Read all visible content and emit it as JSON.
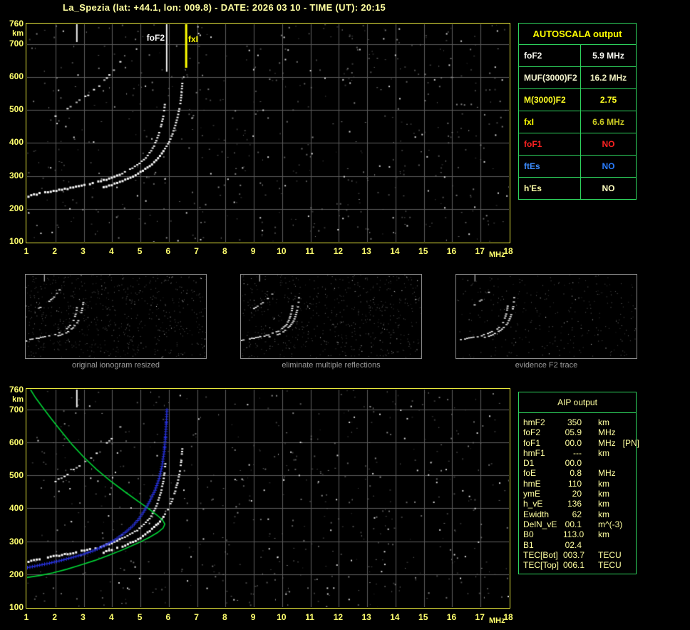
{
  "title": "La_Spezia (lat: +44.1, lon: 009.8) - DATE: 2026 03 10 - TIME (UT): 20:15",
  "colors": {
    "frame": "#e8e83c",
    "grid": "#5c5c5c",
    "axis_text": "#ffff6e",
    "title_text": "#ffffa0",
    "table_border": "#2ed55e",
    "caption_text": "#9c9c9c",
    "green_curve": "#00d435",
    "blue_trace": "#2a35e8",
    "trace_white": "#f5f5f5",
    "noise_gray": "#969696"
  },
  "autoscala": {
    "header": "AUTOSCALA output",
    "rows": [
      {
        "label": "foF2",
        "value": "5.9 MHz",
        "label_color": "#f8f8f0",
        "value_color": "#fbfbf5"
      },
      {
        "label": "MUF(3000)F2",
        "value": "16.2 MHz",
        "label_color": "#f5f5d0",
        "value_color": "#f0f0c0"
      },
      {
        "label": "M(3000)F2",
        "value": "2.75",
        "label_color": "#ffff22",
        "value_color": "#ffff22"
      },
      {
        "label": "fxI",
        "value": "6.6 MHz",
        "label_color": "#ffff00",
        "value_color": "#c8c822"
      },
      {
        "label": "foF1",
        "value": "NO",
        "label_color": "#ff2222",
        "value_color": "#ff2222"
      },
      {
        "label": "ftEs",
        "value": "NO",
        "label_color": "#3d8dff",
        "value_color": "#2a7dff"
      },
      {
        "label": "h'Es",
        "value": "NO",
        "label_color": "#ffffa8",
        "value_color": "#ffffc0"
      }
    ]
  },
  "aip": {
    "header": "AIP output",
    "rows": [
      {
        "label": "hmF2",
        "value": "350",
        "unit": "km",
        "extra": ""
      },
      {
        "label": "foF2",
        "value": "05.9",
        "unit": "MHz",
        "extra": ""
      },
      {
        "label": "foF1",
        "value": "00.0",
        "unit": "MHz",
        "extra": "[PN]"
      },
      {
        "label": "hmF1",
        "value": "---",
        "unit": "km",
        "extra": ""
      },
      {
        "label": "D1",
        "value": "00.0",
        "unit": "",
        "extra": ""
      },
      {
        "label": "foE",
        "value": "0.8",
        "unit": "MHz",
        "extra": ""
      },
      {
        "label": "hmE",
        "value": "110",
        "unit": "km",
        "extra": ""
      },
      {
        "label": "ymE",
        "value": "20",
        "unit": "km",
        "extra": ""
      },
      {
        "label": "h_vE",
        "value": "136",
        "unit": "km",
        "extra": ""
      },
      {
        "label": "Ewidth",
        "value": "62",
        "unit": "km",
        "extra": ""
      },
      {
        "label": "DelN_vE",
        "value": "00.1",
        "unit": "m^(-3)",
        "extra": ""
      },
      {
        "label": "B0",
        "value": "113.0",
        "unit": "km",
        "extra": ""
      },
      {
        "label": "B1",
        "value": "02.4",
        "unit": "",
        "extra": ""
      },
      {
        "label": "TEC[Bot]",
        "value": "003.7",
        "unit": "TECU",
        "extra": ""
      },
      {
        "label": "TEC[Top]",
        "value": "006.1",
        "unit": "TECU",
        "extra": ""
      }
    ]
  },
  "thumbnails": {
    "captions": [
      "original ionogram resized",
      "eliminate multiple reflections",
      "evidence F2 trace"
    ],
    "noise_density": [
      1.0,
      0.92,
      0.45
    ],
    "seeds": [
      111,
      222,
      333
    ]
  },
  "traces": {
    "f2_ordinary": [
      [
        1.05,
        238
      ],
      [
        1.4,
        246
      ],
      [
        1.8,
        252
      ],
      [
        2.2,
        258
      ],
      [
        2.6,
        264
      ],
      [
        3.0,
        271
      ],
      [
        3.4,
        279
      ],
      [
        3.8,
        289
      ],
      [
        4.2,
        302
      ],
      [
        4.6,
        318
      ],
      [
        4.9,
        334
      ],
      [
        5.15,
        352
      ],
      [
        5.35,
        372
      ],
      [
        5.5,
        394
      ],
      [
        5.62,
        420
      ],
      [
        5.72,
        448
      ],
      [
        5.8,
        478
      ],
      [
        5.85,
        508
      ],
      [
        5.88,
        535
      ]
    ],
    "f2_extraordinary": [
      [
        3.7,
        266
      ],
      [
        4.1,
        276
      ],
      [
        4.5,
        289
      ],
      [
        4.9,
        305
      ],
      [
        5.2,
        322
      ],
      [
        5.5,
        343
      ],
      [
        5.75,
        367
      ],
      [
        5.95,
        393
      ],
      [
        6.1,
        420
      ],
      [
        6.22,
        450
      ],
      [
        6.32,
        482
      ],
      [
        6.4,
        515
      ],
      [
        6.45,
        550
      ],
      [
        6.48,
        585
      ]
    ],
    "second_hop": [
      [
        1.9,
        475
      ],
      [
        2.2,
        492
      ],
      [
        2.5,
        508
      ],
      [
        2.8,
        525
      ],
      [
        3.1,
        543
      ],
      [
        3.4,
        562
      ],
      [
        3.65,
        582
      ],
      [
        3.9,
        604
      ],
      [
        4.1,
        625
      ],
      [
        4.3,
        648
      ]
    ],
    "profile_green": [
      [
        1.12,
        760
      ],
      [
        1.3,
        735
      ],
      [
        1.55,
        706
      ],
      [
        1.85,
        672
      ],
      [
        2.2,
        634
      ],
      [
        2.6,
        592
      ],
      [
        3.0,
        555
      ],
      [
        3.45,
        518
      ],
      [
        3.95,
        482
      ],
      [
        4.45,
        450
      ],
      [
        4.9,
        422
      ],
      [
        5.3,
        398
      ],
      [
        5.6,
        378
      ],
      [
        5.78,
        364
      ],
      [
        5.86,
        352
      ],
      [
        5.8,
        340
      ],
      [
        5.6,
        326
      ],
      [
        5.3,
        311
      ],
      [
        4.9,
        294
      ],
      [
        4.4,
        275
      ],
      [
        3.9,
        258
      ],
      [
        3.4,
        242
      ],
      [
        2.9,
        228
      ],
      [
        2.4,
        215
      ],
      [
        1.9,
        204
      ],
      [
        1.45,
        196
      ],
      [
        1.0,
        190
      ]
    ],
    "fitted_blue": [
      [
        1.0,
        221
      ],
      [
        1.35,
        227
      ],
      [
        1.75,
        234
      ],
      [
        2.15,
        242
      ],
      [
        2.55,
        251
      ],
      [
        2.95,
        261
      ],
      [
        3.35,
        273
      ],
      [
        3.7,
        287
      ],
      [
        4.05,
        303
      ],
      [
        4.35,
        321
      ],
      [
        4.65,
        342
      ],
      [
        4.9,
        365
      ],
      [
        5.1,
        390
      ],
      [
        5.3,
        420
      ],
      [
        5.5,
        455
      ],
      [
        5.65,
        492
      ],
      [
        5.75,
        530
      ],
      [
        5.82,
        570
      ],
      [
        5.87,
        615
      ],
      [
        5.9,
        660
      ],
      [
        5.92,
        700
      ]
    ],
    "interference": {
      "freq": 2.73,
      "km_from": 760,
      "km_to": 706
    }
  },
  "chart_data": [
    {
      "id": "ionogram-main",
      "type": "scatter",
      "title": "",
      "xlabel": "MHz",
      "ylabel": "km",
      "xlim": [
        1,
        18
      ],
      "ylim": [
        100,
        760
      ],
      "grid": true,
      "xtick_labels": [
        "1",
        "2",
        "3",
        "4",
        "5",
        "6",
        "7",
        "8",
        "9",
        "10",
        "11",
        "12",
        "13",
        "14",
        "15",
        "16",
        "17",
        "18"
      ],
      "ytick_labels": [
        "760",
        "700",
        "600",
        "500",
        "400",
        "300",
        "200",
        "100"
      ],
      "markers": [
        {
          "label": "foF2",
          "freq": 5.9,
          "km_to": 616,
          "color": "#f8f8f8",
          "width": 2
        },
        {
          "label": "fxI",
          "freq": 6.6,
          "km_to": 628,
          "color": "#ffff00",
          "width": 3
        }
      ],
      "show": [
        "f2_ordinary",
        "f2_extraordinary",
        "second_hop"
      ],
      "seed": 12345
    },
    {
      "id": "ionogram-profile",
      "type": "scatter",
      "title": "",
      "xlabel": "MHz",
      "ylabel": "km",
      "xlim": [
        1,
        18
      ],
      "ylim": [
        100,
        760
      ],
      "grid": true,
      "xtick_labels": [
        "1",
        "2",
        "3",
        "4",
        "5",
        "6",
        "7",
        "8",
        "9",
        "10",
        "11",
        "12",
        "13",
        "14",
        "15",
        "16",
        "17",
        "18"
      ],
      "ytick_labels": [
        "760",
        "700",
        "600",
        "500",
        "400",
        "300",
        "200",
        "100"
      ],
      "markers": [],
      "show": [
        "f2_ordinary",
        "f2_extraordinary",
        "second_hop",
        "profile_green",
        "fitted_blue"
      ],
      "seed": 67890
    }
  ]
}
